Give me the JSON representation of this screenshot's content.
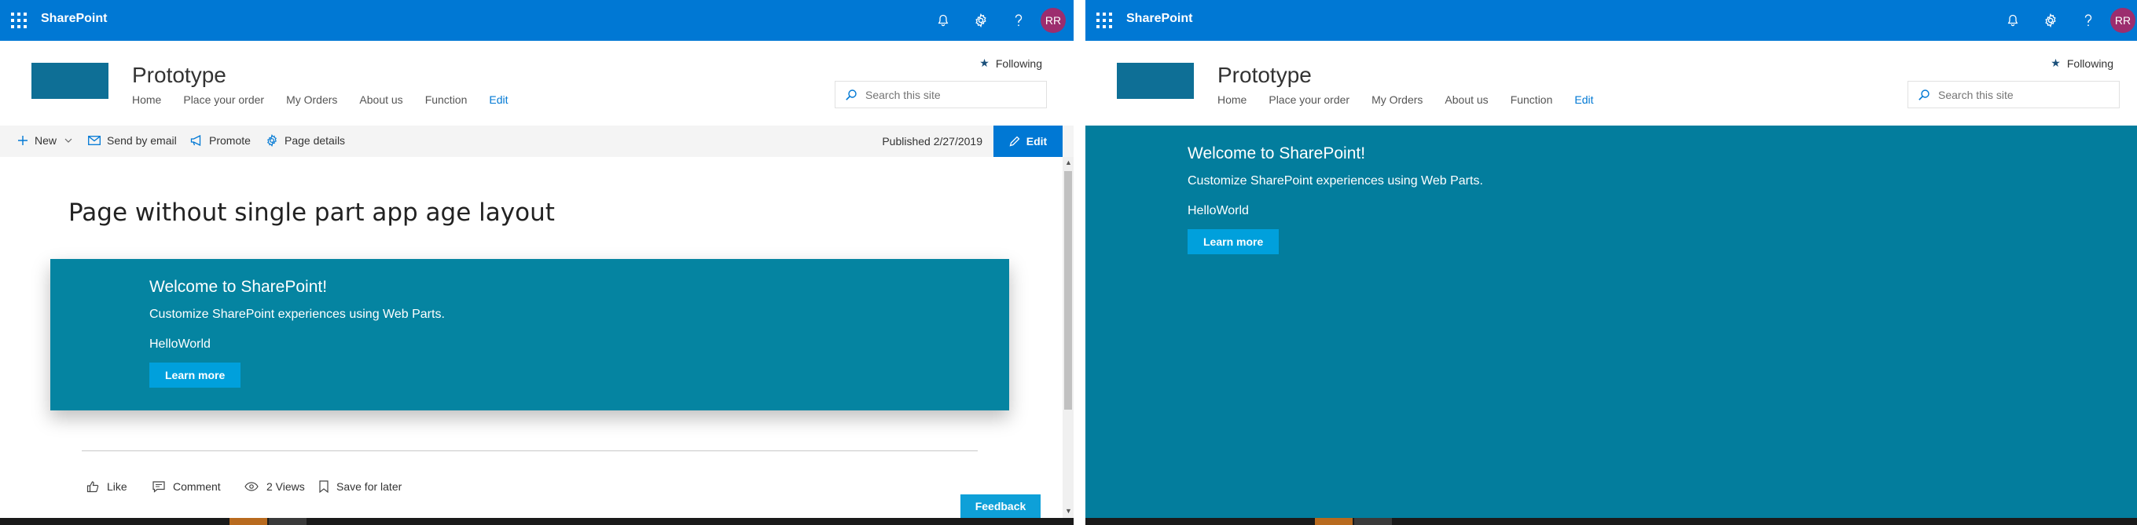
{
  "suitebar": {
    "brand": "SharePoint",
    "avatar_initials": "RR",
    "colors": {
      "bar": "#0078d4",
      "avatar": "#9c2d6e"
    }
  },
  "site": {
    "title": "Prototype",
    "nav": [
      "Home",
      "Place your order",
      "My Orders",
      "About us",
      "Function",
      "Edit"
    ],
    "following_label": "Following",
    "search_placeholder": "Search this site"
  },
  "commandbar": {
    "new_label": "New",
    "send_email_label": "Send by email",
    "promote_label": "Promote",
    "page_details_label": "Page details",
    "published_label": "Published 2/27/2019",
    "edit_label": "Edit"
  },
  "page": {
    "title": "Page without single part app age layout"
  },
  "hero": {
    "welcome": "Welcome to SharePoint!",
    "description": "Customize SharePoint experiences using Web Parts.",
    "hello": "HelloWorld",
    "button": "Learn more",
    "color": "#0584a1"
  },
  "social": {
    "like": "Like",
    "comment": "Comment",
    "views": "2 Views",
    "save_for_later": "Save for later"
  },
  "feedback_label": "Feedback"
}
